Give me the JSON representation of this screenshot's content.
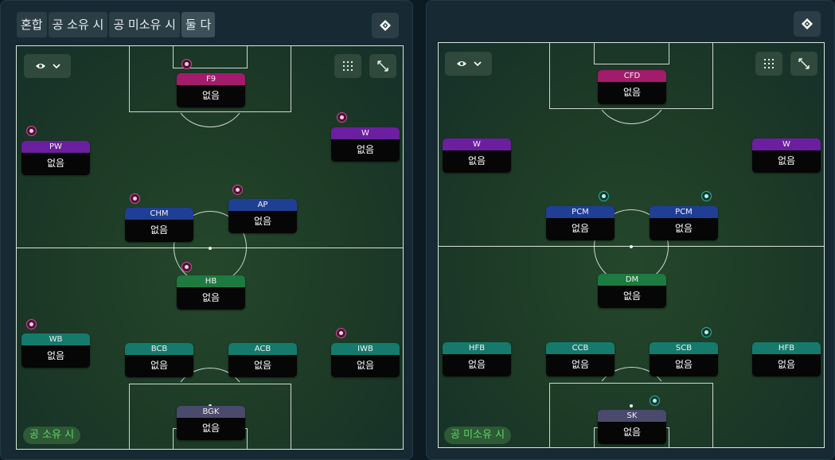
{
  "tabs": [
    {
      "label": "혼합",
      "active": false
    },
    {
      "label": "공 소유 시",
      "active": false
    },
    {
      "label": "공 미소유 시",
      "active": false
    },
    {
      "label": "둘 다",
      "active": true
    }
  ],
  "icons": {
    "corner": "diamond-arrows-icon",
    "eye": "eye-icon",
    "chevron": "chevron-down-icon",
    "grid": "dotted-grid-icon",
    "expand": "expand-icon"
  },
  "left": {
    "phase_label": "공 소유 시",
    "positions": {
      "f9": {
        "role": "F9",
        "value": "없음"
      },
      "pw": {
        "role": "PW",
        "value": "없음"
      },
      "w": {
        "role": "W",
        "value": "없음"
      },
      "chm": {
        "role": "CHM",
        "value": "없음"
      },
      "ap": {
        "role": "AP",
        "value": "없음"
      },
      "hb": {
        "role": "HB",
        "value": "없음"
      },
      "wb": {
        "role": "WB",
        "value": "없음"
      },
      "bcb": {
        "role": "BCB",
        "value": "없음"
      },
      "acb": {
        "role": "ACB",
        "value": "없음"
      },
      "iwb": {
        "role": "IWB",
        "value": "없음"
      },
      "bgk": {
        "role": "BGK",
        "value": "없음"
      }
    }
  },
  "right": {
    "phase_label": "공 미소유 시",
    "positions": {
      "cfd": {
        "role": "CFD",
        "value": "없음"
      },
      "w_left": {
        "role": "W",
        "value": "없음"
      },
      "w_right": {
        "role": "W",
        "value": "없음"
      },
      "pcm_left": {
        "role": "PCM",
        "value": "없음"
      },
      "pcm_right": {
        "role": "PCM",
        "value": "없음"
      },
      "dm": {
        "role": "DM",
        "value": "없음"
      },
      "hfb_left": {
        "role": "HFB",
        "value": "없음"
      },
      "ccb": {
        "role": "CCB",
        "value": "없음"
      },
      "scb": {
        "role": "SCB",
        "value": "없음"
      },
      "hfb_right": {
        "role": "HFB",
        "value": "없음"
      },
      "sk": {
        "role": "SK",
        "value": "없음"
      }
    }
  },
  "colors": {
    "attack": "#a21c6b",
    "wide": "#6b1fa0",
    "midfield": "#1f3f95",
    "holding": "#1d7a40",
    "defence": "#157a6c",
    "keeper": "#4a4a6c",
    "phase_text": "#62d46a"
  }
}
